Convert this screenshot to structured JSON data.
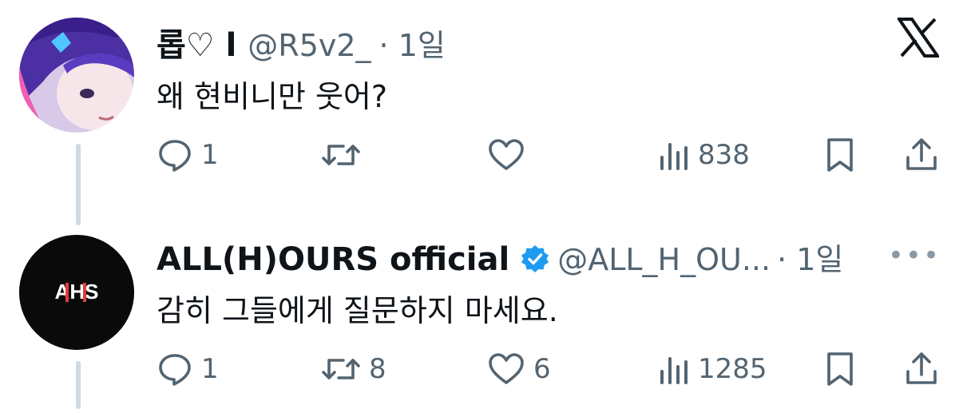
{
  "tweets": [
    {
      "name": "롭♡ l",
      "handle": "@R5v2_",
      "time": "· 1일",
      "text": "왜 현비니만 웃어?",
      "replies": "1",
      "retweets": "",
      "likes": "",
      "views": "838"
    },
    {
      "name": "ALL(H)OURS official",
      "handle": "@ALL_H_OU...",
      "time": "· 1일",
      "text": "감히 그들에게 질문하지 마세요.",
      "replies": "1",
      "retweets": "8",
      "likes": "6",
      "views": "1285",
      "avatar_text": "AHS"
    }
  ],
  "icons": [
    "x-logo-icon",
    "reply-icon",
    "retweet-icon",
    "like-icon",
    "views-icon",
    "bookmark-icon",
    "share-icon",
    "verified-badge-icon",
    "more-icon"
  ],
  "colors": {
    "text": "#0f1419",
    "muted": "#536471",
    "verified": "#1d9bf0",
    "line": "#cfd9de"
  }
}
